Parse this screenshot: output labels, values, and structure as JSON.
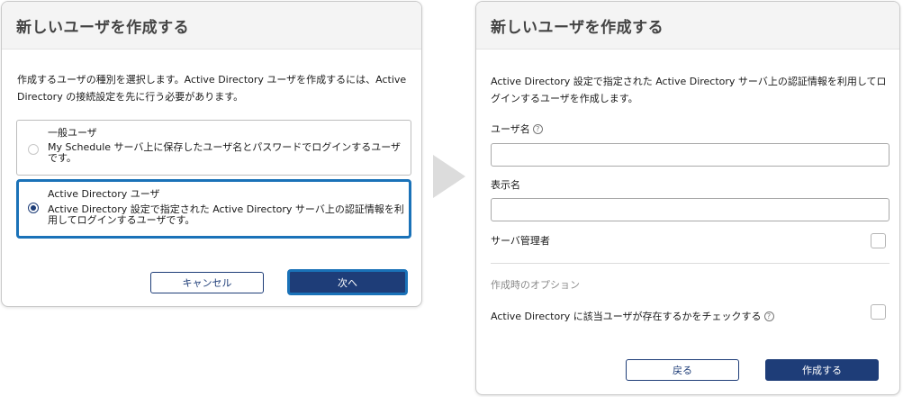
{
  "dialog1": {
    "title": "新しいユーザを作成する",
    "description": "作成するユーザの種別を選択します。Active Directory ユーザを作成するには、Active Directory の接続設定を先に行う必要があります。",
    "options": [
      {
        "title": "一般ユーザ",
        "desc": "My Schedule サーバ上に保存したユーザ名とパスワードでログインするユーザです。",
        "selected": false
      },
      {
        "title": "Active Directory ユーザ",
        "desc": "Active Directory 設定で指定された Active Directory サーバ上の認証情報を利用してログインするユーザです。",
        "selected": true
      }
    ],
    "cancel_label": "キャンセル",
    "next_label": "次へ"
  },
  "dialog2": {
    "title": "新しいユーザを作成する",
    "description": "Active Directory 設定で指定された Active Directory サーバ上の認証情報を利用してログインするユーザを作成します。",
    "username_label": "ユーザ名",
    "displayname_label": "表示名",
    "admin_label": "サーバ管理者",
    "options_section": "作成時のオプション",
    "check_label": "Active Directory に該当ユーザが存在するかをチェックする",
    "back_label": "戻る",
    "create_label": "作成する"
  },
  "icons": {
    "help": "help-circle-icon",
    "step_arrow": "triangle-right-icon"
  },
  "colors": {
    "primary": "#1e3d78",
    "focus": "#1a72b8",
    "header_bg": "#f4f4f4",
    "arrow": "#dcdcdc"
  }
}
